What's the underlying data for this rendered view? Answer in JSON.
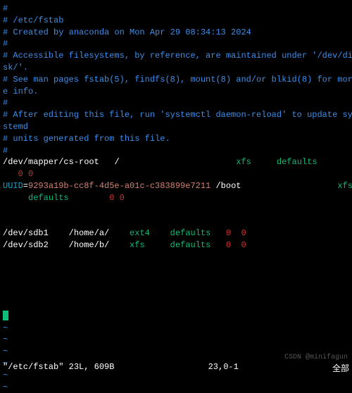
{
  "comments": {
    "l1": "#",
    "l2": "# /etc/fstab",
    "l3": "# Created by anaconda on Mon Apr 29 08:34:13 2024",
    "l4": "#",
    "l5": "# Accessible filesystems, by reference, are maintained under '/dev/di",
    "l6": "sk/'.",
    "l7": "# See man pages fstab(5), findfs(8), mount(8) and/or blkid(8) for mor",
    "l8": "e info.",
    "l9": "#",
    "l10": "# After editing this file, run 'systemctl daemon-reload' to update sy",
    "l11": "stemd",
    "l12": "# units generated from this file.",
    "l13": "#"
  },
  "entry1": {
    "device": "/dev/mapper/cs-root",
    "mount": "/",
    "fs": "xfs",
    "opts": "defaults",
    "d1": "0",
    "d2": "0"
  },
  "entry2": {
    "label": "UUID",
    "eq": "=",
    "uuid": "9293a19b-cc8f-4d5e-a01c-c383899e7211",
    "mount": "/boot",
    "fs": "xfs",
    "opts": "defaults",
    "d1": "0",
    "d2": "0"
  },
  "entry3": {
    "device": "/dev/sdb1",
    "mount": "/home/a/",
    "fs": "ext4",
    "opts": "defaults",
    "d1": "0",
    "d2": "0"
  },
  "entry4": {
    "device": "/dev/sdb2",
    "mount": "/home/b/",
    "fs": "xfs",
    "opts": "defaults",
    "d1": "0",
    "d2": "0"
  },
  "tilde": "~",
  "status": {
    "file": "\"/etc/fstab\" 23L, 609B",
    "pos": "23,0-1",
    "mode": "全部"
  },
  "watermark": "CSDN @minifagun"
}
